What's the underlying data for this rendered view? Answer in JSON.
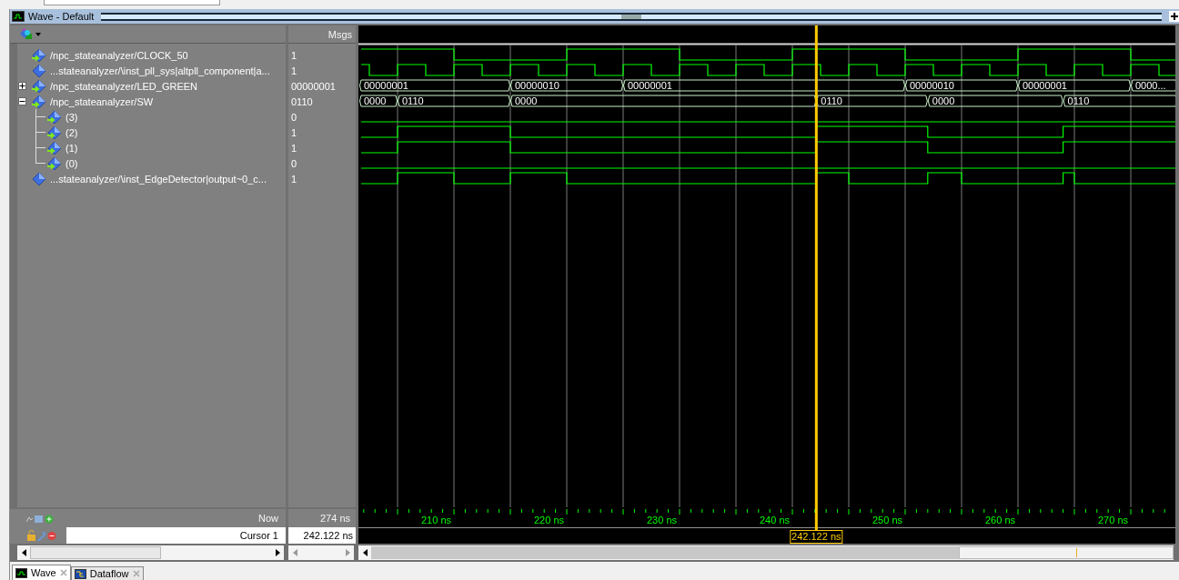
{
  "window": {
    "title": "Wave - Default"
  },
  "columns": {
    "values_header": "Msgs"
  },
  "signals": [
    {
      "name": "/npc_stateanalyzer/CLOCK_50",
      "value": "1",
      "kind": "bit",
      "input": true
    },
    {
      "name": "...stateanalyzer/\\inst_pll_sys|altpll_component|a...",
      "value": "1",
      "kind": "bit",
      "input": false
    },
    {
      "name": "/npc_stateanalyzer/LED_GREEN",
      "value": "00000001",
      "kind": "bus",
      "input": true,
      "expanded": false,
      "segments": [
        "00000001",
        "00000010",
        "00000001",
        "00000010",
        "00000001",
        "0000..."
      ]
    },
    {
      "name": "/npc_stateanalyzer/SW",
      "value": "0110",
      "kind": "bus",
      "input": true,
      "expanded": true,
      "segments": [
        "0000",
        "0110",
        "0000",
        "0110",
        "0000",
        "0110"
      ],
      "children": [
        {
          "name": "(3)",
          "value": "0",
          "kind": "bit",
          "input": true
        },
        {
          "name": "(2)",
          "value": "1",
          "kind": "bit",
          "input": true
        },
        {
          "name": "(1)",
          "value": "1",
          "kind": "bit",
          "input": true
        },
        {
          "name": "(0)",
          "value": "0",
          "kind": "bit",
          "input": true
        }
      ]
    },
    {
      "name": "...stateanalyzer/\\inst_EdgeDetector|output~0_c...",
      "value": "1",
      "kind": "bit",
      "input": false
    }
  ],
  "timeline": {
    "now_label": "Now",
    "now_value": "274 ns",
    "cursor_label": "Cursor 1",
    "cursor_value": "242.122 ns",
    "cursor_tag": "242.122 ns",
    "ticks": [
      "210 ns",
      "220 ns",
      "230 ns",
      "240 ns",
      "250 ns",
      "260 ns",
      "270 ns"
    ]
  },
  "tabs": [
    {
      "label": "Wave",
      "selected": true
    },
    {
      "label": "Dataflow",
      "selected": false
    }
  ]
}
